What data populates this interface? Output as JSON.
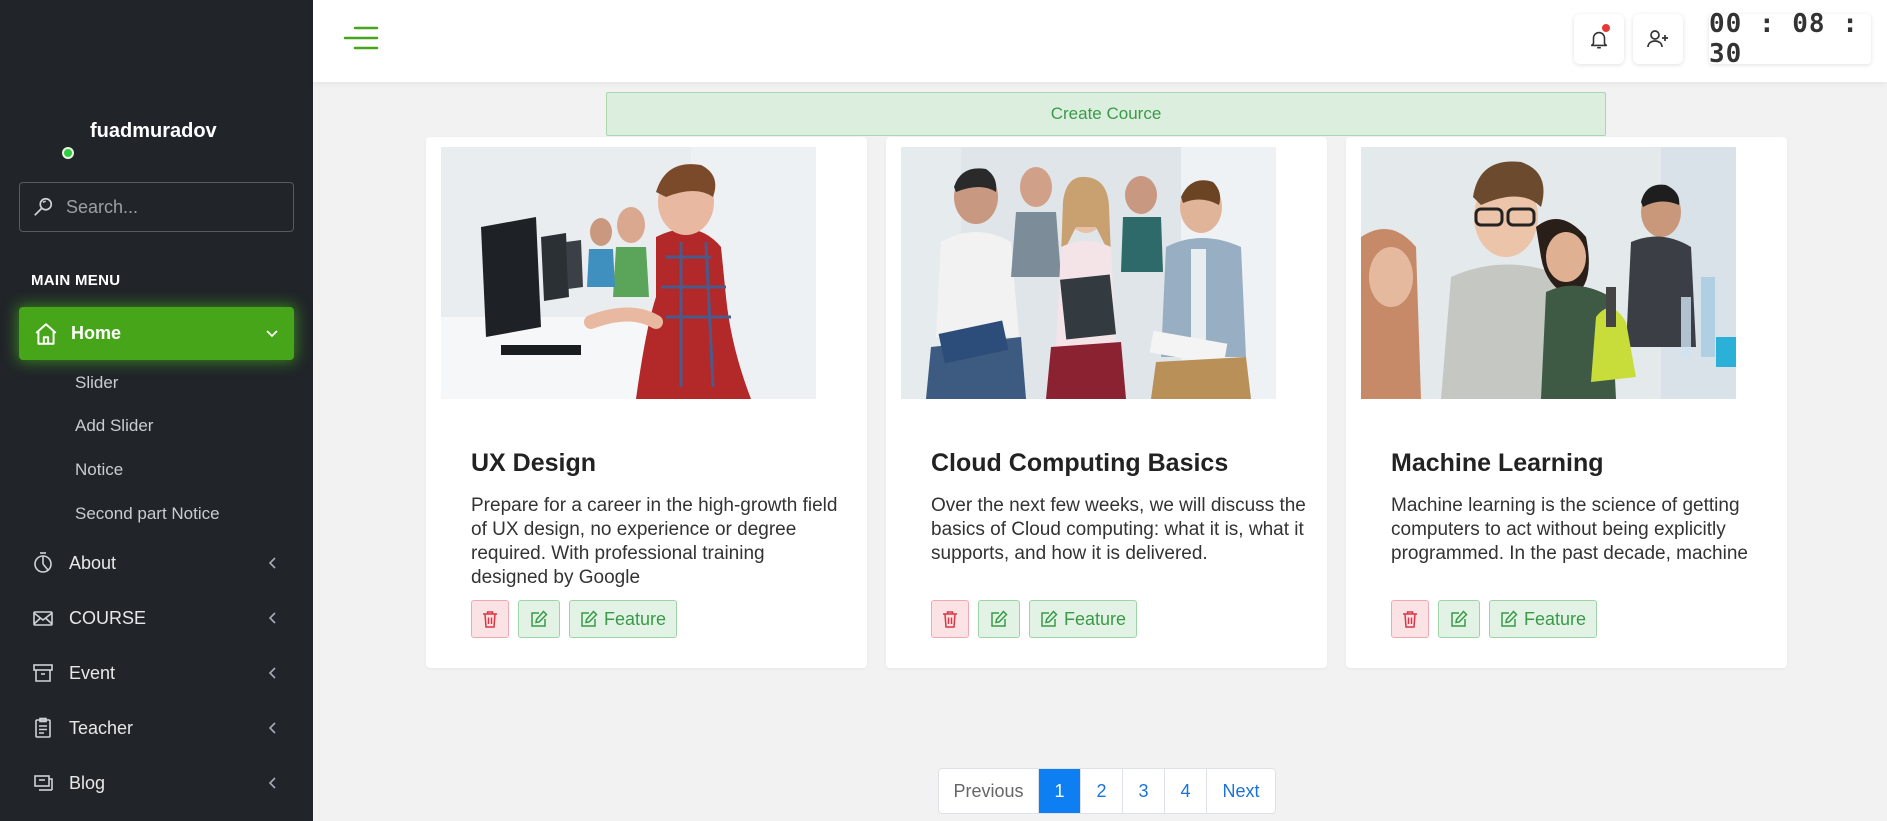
{
  "user": {
    "name": "fuadmuradov",
    "status_color": "#2ecc40"
  },
  "search": {
    "placeholder": "Search..."
  },
  "sidebar": {
    "heading": "MAIN MENU",
    "home": {
      "label": "Home",
      "icon": "home-icon",
      "color": "#47a51a"
    },
    "home_subitems": [
      "Slider",
      "Add Slider",
      "Notice",
      "Second part Notice"
    ],
    "items": [
      {
        "label": "About",
        "icon": "pie-chart-icon"
      },
      {
        "label": "COURSE",
        "icon": "envelope-icon"
      },
      {
        "label": "Event",
        "icon": "archive-icon"
      },
      {
        "label": "Teacher",
        "icon": "clipboard-icon"
      },
      {
        "label": "Blog",
        "icon": "monitor-icon"
      }
    ]
  },
  "topbar": {
    "menu_icon": "hamburger-icon",
    "notification_icon": "bell-icon",
    "add_user_icon": "user-plus-icon",
    "clock": "00 : 08 : 30"
  },
  "create_button": {
    "label": "Create Cource"
  },
  "courses": [
    {
      "title": "UX Design",
      "description": "Prepare for a career in the high-growth field of UX design, no experience or degree required. With professional training designed by Google",
      "feature_label": "Feature"
    },
    {
      "title": "Cloud Computing Basics",
      "description": "Over the next few weeks, we will discuss the basics of Cloud computing: what it is, what it supports, and how it is delivered.",
      "feature_label": "Feature"
    },
    {
      "title": "Machine Learning",
      "description": "Machine learning is the science of getting computers to act without being explicitly programmed. In the past decade, machine",
      "feature_label": "Feature"
    }
  ],
  "pagination": {
    "previous": "Previous",
    "pages": [
      "1",
      "2",
      "3",
      "4"
    ],
    "active": "1",
    "next": "Next"
  }
}
